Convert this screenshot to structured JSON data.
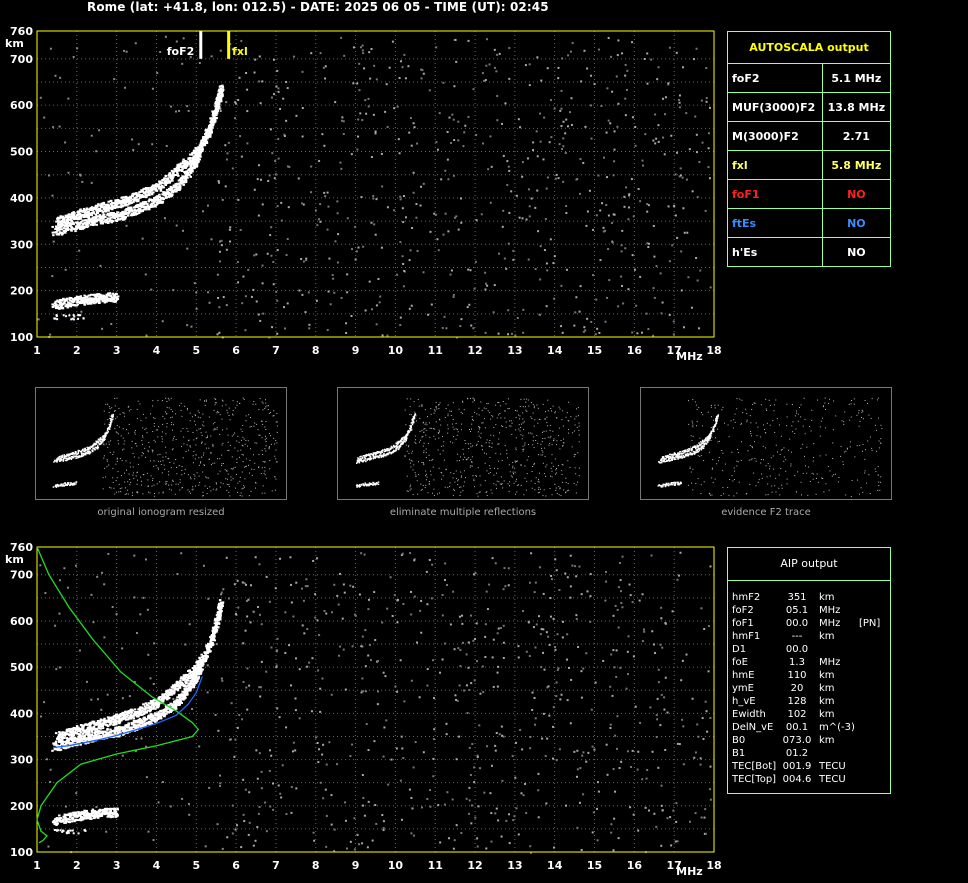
{
  "header": "Rome (lat: +41.8, lon: 012.5) - DATE: 2025 06 05 - TIME (UT): 02:45",
  "chart_data": [
    {
      "type": "scatter",
      "title": "",
      "xlabel": "MHz",
      "ylabel": "km",
      "xlim": [
        1,
        18
      ],
      "ylim": [
        100,
        760
      ],
      "x_ticks": [
        "1",
        "2",
        "3",
        "4",
        "5",
        "6",
        "7",
        "8",
        "9",
        "10",
        "11",
        "12",
        "13",
        "14",
        "15",
        "16",
        "17",
        "18"
      ],
      "y_ticks": [
        "100",
        "200",
        "300",
        "400",
        "500",
        "600",
        "700",
        "760"
      ],
      "grid": true,
      "markers": [
        {
          "label": "foF2",
          "x": 5.1,
          "color": "#ffffff"
        },
        {
          "label": "fxl",
          "x": 5.8,
          "color": "#ffff00"
        }
      ],
      "series": [
        {
          "values": [
            [
              1.4,
              330
            ],
            [
              2,
              342
            ],
            [
              2.5,
              355
            ],
            [
              3,
              362
            ],
            [
              3.5,
              378
            ],
            [
              4,
              395
            ],
            [
              4.5,
              425
            ],
            [
              4.9,
              470
            ],
            [
              5.1,
              510
            ]
          ]
        },
        {
          "values": [
            [
              1.5,
              350
            ],
            [
              2,
              365
            ],
            [
              2.5,
              378
            ],
            [
              3,
              390
            ],
            [
              3.5,
              405
            ],
            [
              4,
              425
            ],
            [
              4.5,
              460
            ],
            [
              5,
              500
            ],
            [
              5.3,
              545
            ],
            [
              5.5,
              600
            ],
            [
              5.6,
              640
            ]
          ]
        },
        {
          "values": [
            [
              1.4,
              170
            ],
            [
              2,
              180
            ],
            [
              2.5,
              185
            ],
            [
              3,
              188
            ]
          ]
        }
      ]
    },
    {
      "type": "line",
      "title": "",
      "xlabel": "MHz",
      "ylabel": "km",
      "xlim": [
        1,
        18
      ],
      "ylim": [
        100,
        760
      ],
      "x_ticks": [
        "1",
        "2",
        "3",
        "4",
        "5",
        "6",
        "7",
        "8",
        "9",
        "10",
        "11",
        "12",
        "13",
        "14",
        "15",
        "16",
        "17",
        "18"
      ],
      "y_ticks": [
        "100",
        "200",
        "300",
        "400",
        "500",
        "600",
        "700",
        "760"
      ],
      "grid": true,
      "series": [
        {
          "color": "#22dd22",
          "values": [
            [
              1,
              760
            ],
            [
              1.3,
              700
            ],
            [
              1.8,
              630
            ],
            [
              2.4,
              560
            ],
            [
              3.1,
              490
            ],
            [
              3.9,
              435
            ],
            [
              4.5,
              405
            ],
            [
              4.9,
              380
            ],
            [
              5.05,
              365
            ],
            [
              4.9,
              350
            ],
            [
              4,
              330
            ],
            [
              3,
              312
            ],
            [
              2.1,
              290
            ],
            [
              1.5,
              250
            ],
            [
              1.1,
              200
            ],
            [
              1,
              170
            ],
            [
              1.1,
              145
            ],
            [
              1.25,
              135
            ],
            [
              1.15,
              125
            ],
            [
              1.05,
              120
            ]
          ]
        },
        {
          "color": "#2266ff",
          "values": [
            [
              1.4,
              326
            ],
            [
              1.8,
              330
            ],
            [
              2.5,
              342
            ],
            [
              3,
              352
            ],
            [
              3.5,
              365
            ],
            [
              4,
              378
            ],
            [
              4.5,
              396
            ],
            [
              4.8,
              420
            ],
            [
              5.0,
              445
            ],
            [
              5.15,
              480
            ]
          ]
        }
      ]
    }
  ],
  "thumbs": [
    {
      "caption": "original ionogram resized"
    },
    {
      "caption": "eliminate multiple reflections"
    },
    {
      "caption": "evidence F2 trace"
    }
  ],
  "autoscala": {
    "title": "AUTOSCALA output",
    "rows": [
      {
        "label": "foF2",
        "value": "5.1 MHz",
        "color": "#ffffff"
      },
      {
        "label": "MUF(3000)F2",
        "value": "13.8 MHz",
        "color": "#ffffff"
      },
      {
        "label": "M(3000)F2",
        "value": "2.71",
        "color": "#ffffff"
      },
      {
        "label": "fxl",
        "value": "5.8 MHz",
        "color": "#ffff66"
      },
      {
        "label": "foF1",
        "value": "NO",
        "color": "#ff2020"
      },
      {
        "label": "ftEs",
        "value": "NO",
        "color": "#3a8cff"
      },
      {
        "label": "h'Es",
        "value": "NO",
        "color": "#ffffff"
      }
    ]
  },
  "aip": {
    "title": "AIP output",
    "rows": [
      {
        "k": "hmF2",
        "v": "351",
        "u": "km",
        "x": ""
      },
      {
        "k": "foF2",
        "v": "05.1",
        "u": "MHz",
        "x": ""
      },
      {
        "k": "foF1",
        "v": "00.0",
        "u": "MHz",
        "x": "[PN]"
      },
      {
        "k": "hmF1",
        "v": "---",
        "u": "km",
        "x": ""
      },
      {
        "k": "D1",
        "v": "00.0",
        "u": "",
        "x": ""
      },
      {
        "k": "foE",
        "v": "1.3",
        "u": "MHz",
        "x": ""
      },
      {
        "k": "hmE",
        "v": "110",
        "u": "km",
        "x": ""
      },
      {
        "k": "ymE",
        "v": "20",
        "u": "km",
        "x": ""
      },
      {
        "k": "h_vE",
        "v": "128",
        "u": "km",
        "x": ""
      },
      {
        "k": "Ewidth",
        "v": "102",
        "u": "km",
        "x": ""
      },
      {
        "k": "DelN_vE",
        "v": "00.1",
        "u": "m^(-3)",
        "x": ""
      },
      {
        "k": "B0",
        "v": "073.0",
        "u": "km",
        "x": ""
      },
      {
        "k": "B1",
        "v": "01.2",
        "u": "",
        "x": ""
      },
      {
        "k": "TEC[Bot]",
        "v": "001.9",
        "u": "TECU",
        "x": ""
      },
      {
        "k": "TEC[Top]",
        "v": "004.6",
        "u": "TECU",
        "x": ""
      }
    ]
  }
}
